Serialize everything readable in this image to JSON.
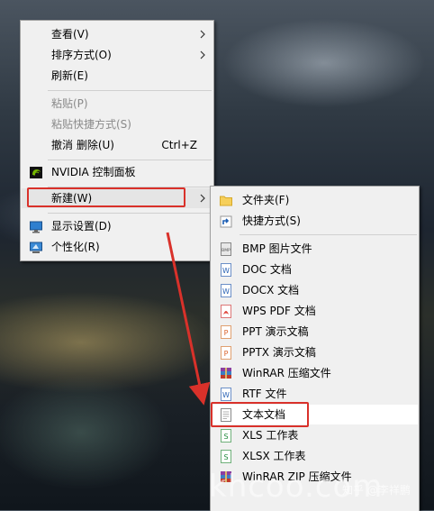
{
  "context_menu": {
    "items": [
      {
        "label": "查看(V)"
      },
      {
        "label": "排序方式(O)"
      },
      {
        "label": "刷新(E)"
      },
      {
        "label": "粘贴(P)"
      },
      {
        "label": "粘贴快捷方式(S)"
      },
      {
        "label": "撤消 删除(U)",
        "shortcut": "Ctrl+Z"
      },
      {
        "label": "NVIDIA 控制面板"
      },
      {
        "label": "新建(W)"
      },
      {
        "label": "显示设置(D)"
      },
      {
        "label": "个性化(R)"
      }
    ]
  },
  "new_submenu": {
    "items": [
      {
        "label": "文件夹(F)",
        "icon": "folder-icon"
      },
      {
        "label": "快捷方式(S)",
        "icon": "shortcut-icon"
      },
      {
        "label": "BMP 图片文件",
        "icon": "bmp-file-icon"
      },
      {
        "label": "DOC 文档",
        "icon": "doc-file-icon"
      },
      {
        "label": "DOCX 文档",
        "icon": "docx-file-icon"
      },
      {
        "label": "WPS PDF 文档",
        "icon": "pdf-file-icon"
      },
      {
        "label": "PPT 演示文稿",
        "icon": "ppt-file-icon"
      },
      {
        "label": "PPTX 演示文稿",
        "icon": "pptx-file-icon"
      },
      {
        "label": "WinRAR 压缩文件",
        "icon": "winrar-icon"
      },
      {
        "label": "RTF 文件",
        "icon": "rtf-file-icon"
      },
      {
        "label": "文本文档",
        "icon": "text-file-icon"
      },
      {
        "label": "XLS 工作表",
        "icon": "xls-file-icon"
      },
      {
        "label": "XLSX 工作表",
        "icon": "xlsx-file-icon"
      },
      {
        "label": "WinRAR ZIP 压缩文件",
        "icon": "zip-file-icon"
      }
    ]
  },
  "watermarks": {
    "site": "khcoo.com",
    "author": "知乎 @李祥鹏"
  },
  "colors": {
    "highlight": "#d9312a",
    "menu_bg": "#f0f0f0"
  }
}
